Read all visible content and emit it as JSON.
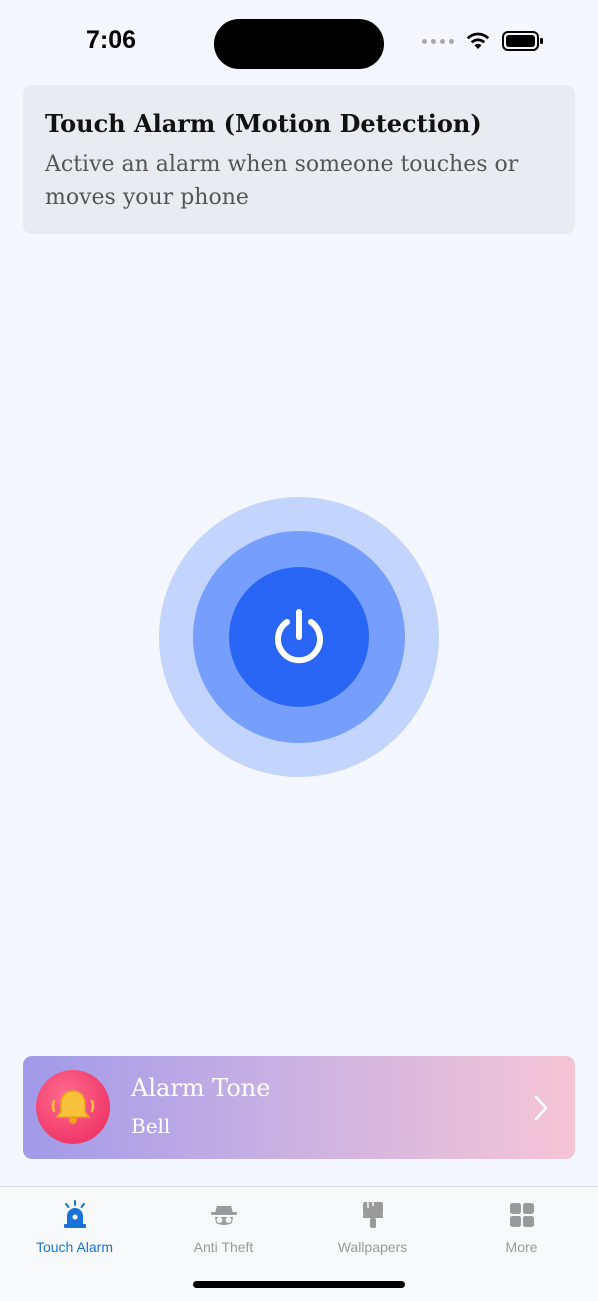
{
  "status_bar": {
    "time": "7:06"
  },
  "header": {
    "title": "Touch Alarm (Motion Detection)",
    "description": "Active an alarm when someone touches or moves your phone"
  },
  "power_button": {
    "icon": "power-icon",
    "colors": {
      "outer_ring": "#c3d5fd",
      "middle_ring": "#769efc",
      "button": "#2a66f5"
    }
  },
  "alarm_tone": {
    "title": "Alarm Tone",
    "value": "Bell",
    "icon": "bell-icon"
  },
  "tab_bar": {
    "tabs": [
      {
        "label": "Touch Alarm",
        "icon": "siren-icon",
        "active": true
      },
      {
        "label": "Anti Theft",
        "icon": "spy-icon",
        "active": false
      },
      {
        "label": "Wallpapers",
        "icon": "paint-brush-icon",
        "active": false
      },
      {
        "label": "More",
        "icon": "grid-icon",
        "active": false
      }
    ],
    "active_color": "#1a73d9",
    "inactive_color": "#9a9a9a"
  }
}
